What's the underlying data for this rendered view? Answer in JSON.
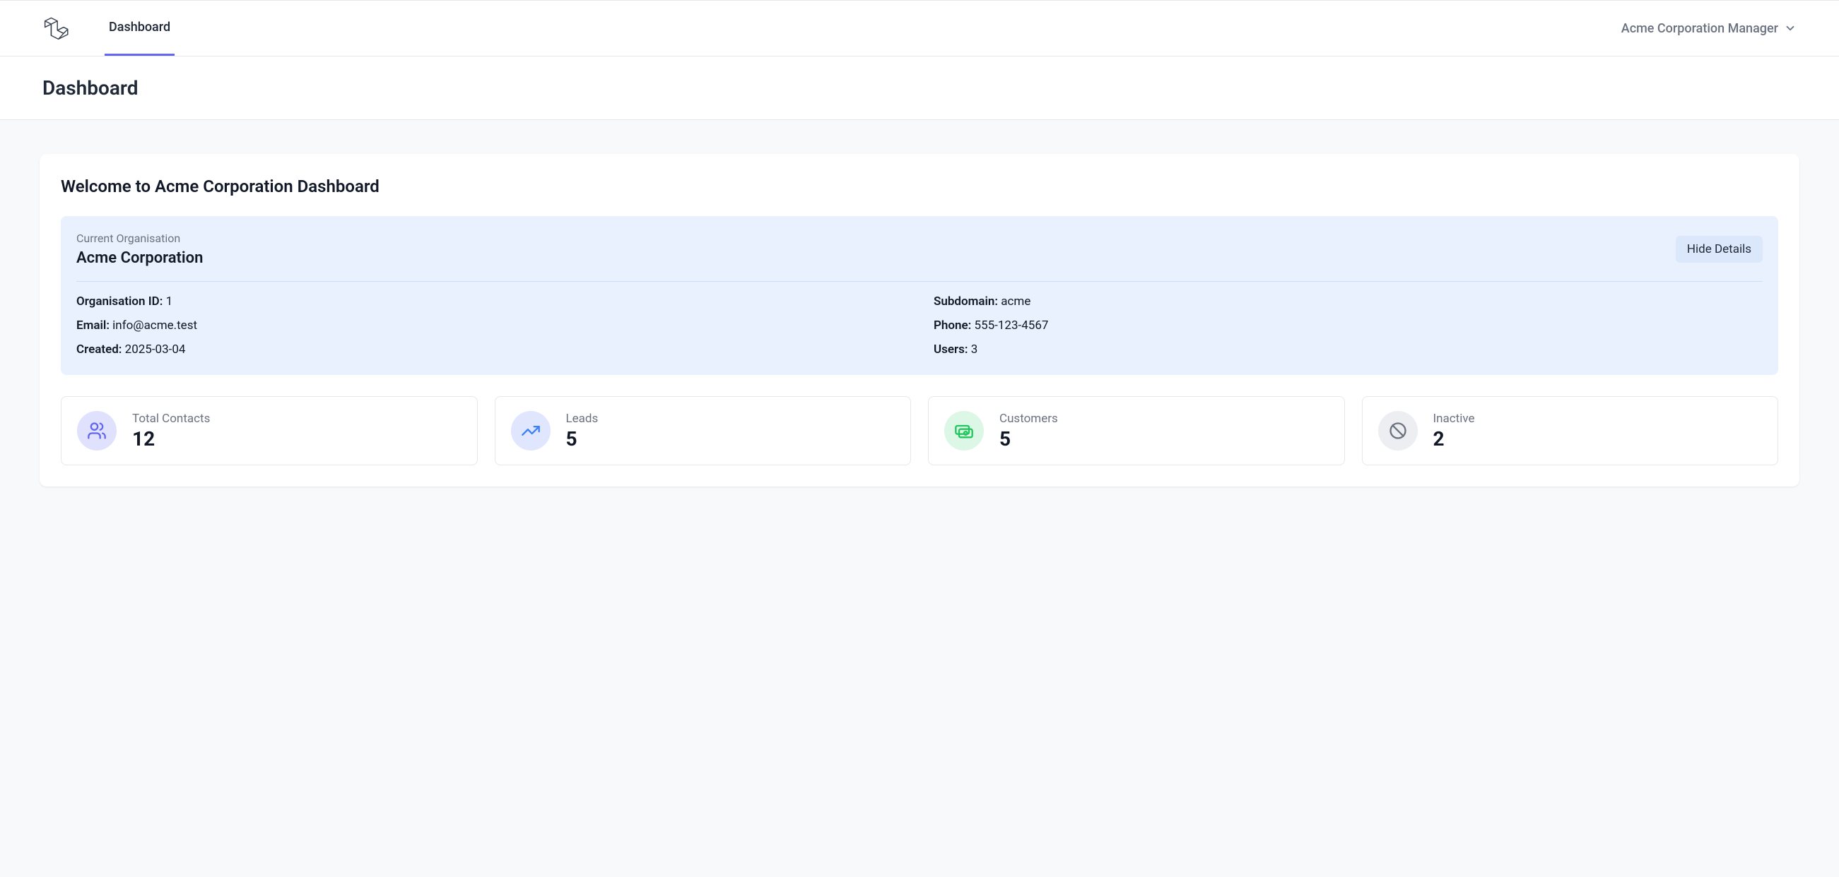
{
  "nav": {
    "dashboard": "Dashboard",
    "user_menu": "Acme Corporation Manager"
  },
  "page": {
    "title": "Dashboard"
  },
  "welcome": "Welcome to Acme Corporation Dashboard",
  "org": {
    "label": "Current Organisation",
    "name": "Acme Corporation",
    "hide_details": "Hide Details",
    "fields": {
      "id_label": "Organisation ID:",
      "id_value": "1",
      "subdomain_label": "Subdomain:",
      "subdomain_value": "acme",
      "email_label": "Email:",
      "email_value": "info@acme.test",
      "phone_label": "Phone:",
      "phone_value": "555-123-4567",
      "created_label": "Created:",
      "created_value": "2025-03-04",
      "users_label": "Users:",
      "users_value": "3"
    }
  },
  "stats": {
    "total_contacts": {
      "label": "Total Contacts",
      "value": "12"
    },
    "leads": {
      "label": "Leads",
      "value": "5"
    },
    "customers": {
      "label": "Customers",
      "value": "5"
    },
    "inactive": {
      "label": "Inactive",
      "value": "2"
    }
  }
}
